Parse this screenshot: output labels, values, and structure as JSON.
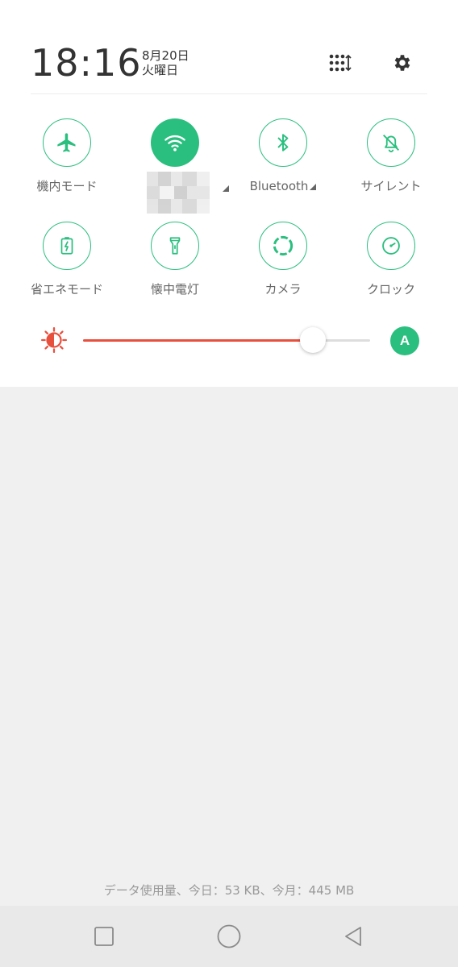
{
  "header": {
    "time": "18:16",
    "date": "8月20日",
    "weekday": "火曜日"
  },
  "icons": {
    "edit": "grid-edit-icon",
    "settings": "gear-icon"
  },
  "tiles": [
    {
      "label": "機内モード",
      "icon": "airplane-icon",
      "active": false
    },
    {
      "label": "",
      "icon": "wifi-icon",
      "active": true
    },
    {
      "label": "Bluetooth",
      "icon": "bluetooth-icon",
      "active": false
    },
    {
      "label": "サイレント",
      "icon": "silent-bell-icon",
      "active": false
    },
    {
      "label": "省エネモード",
      "icon": "battery-saver-icon",
      "active": false
    },
    {
      "label": "懐中電灯",
      "icon": "flashlight-icon",
      "active": false
    },
    {
      "label": "カメラ",
      "icon": "camera-icon",
      "active": false
    },
    {
      "label": "クロック",
      "icon": "clock-icon",
      "active": false
    }
  ],
  "brightness": {
    "level_percent": 80,
    "auto_label": "A"
  },
  "data_usage": "データ使用量、今日：53 KB、今月：445 MB",
  "colors": {
    "accent": "#2bbf7f",
    "brightness_fill": "#e8503e",
    "background": "#f0f0f0"
  }
}
